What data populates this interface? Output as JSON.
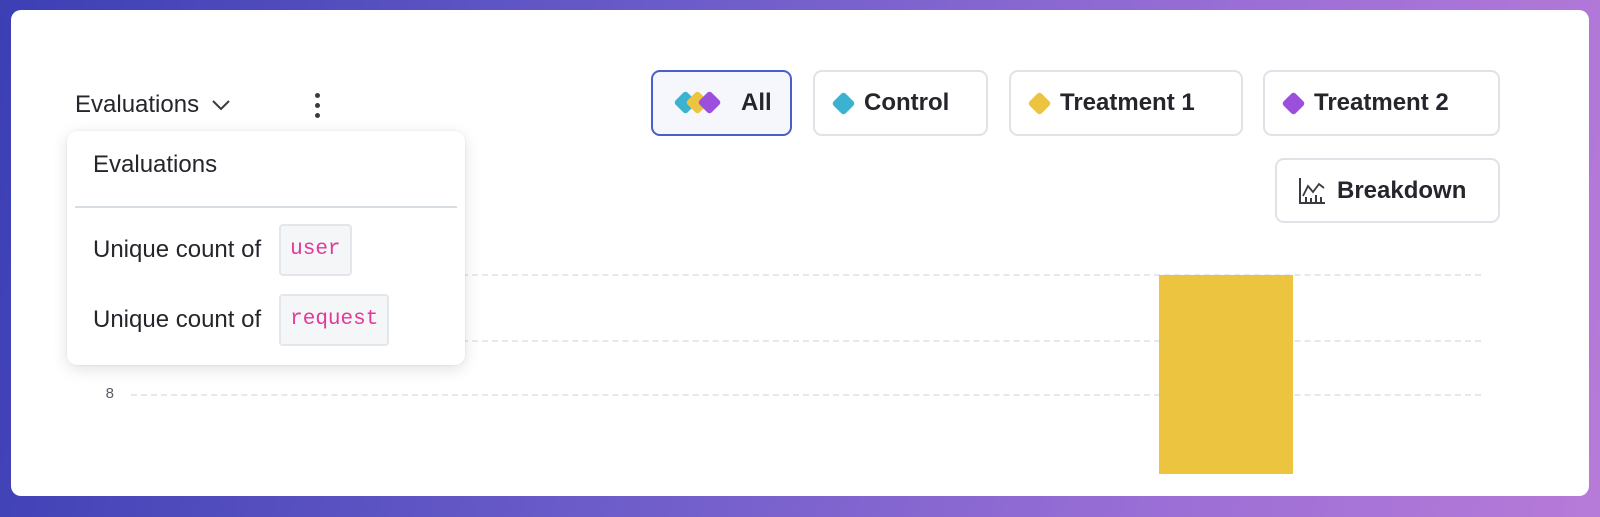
{
  "header": {
    "metric_label": "Evaluations"
  },
  "filters": [
    {
      "label": "All",
      "active": true
    },
    {
      "label": "Control",
      "color": "#3bb2d0"
    },
    {
      "label": "Treatment 1",
      "color": "#ecc43f"
    },
    {
      "label": "Treatment 2",
      "color": "#9b4fdc"
    }
  ],
  "breakdown": {
    "label": "Breakdown"
  },
  "menu": {
    "title": "Evaluations",
    "items": [
      {
        "label": "Unique count of",
        "code": "user"
      },
      {
        "label": "Unique count of",
        "code": "request"
      }
    ]
  },
  "chart_data": {
    "type": "bar",
    "y_ticks": [
      "8"
    ],
    "bars": [
      {
        "series": "Treatment 1",
        "color": "#ecc43f"
      }
    ]
  }
}
